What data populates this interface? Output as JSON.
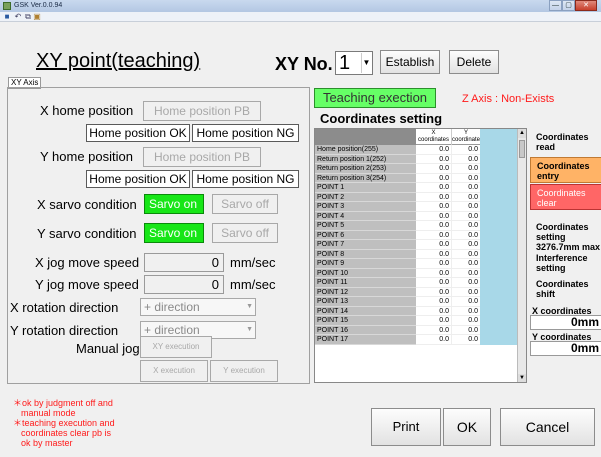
{
  "window": {
    "title": "GSK Ver.0.0.94",
    "minimize": "—",
    "maximize": "▢",
    "close": "✕"
  },
  "toolbar": {
    "icons": [
      "save-icon",
      "undo-icon",
      "copy-icon",
      "paste-icon"
    ]
  },
  "header": {
    "title": "XY point(teaching)",
    "xy_axis_tag": "XY Axis",
    "xy_no_label": "XY No.",
    "xy_no_value": "1",
    "establish_label": "Establish",
    "delete_label": "Delete"
  },
  "left": {
    "x_home_label": "X home position",
    "x_home_pb": "Home position PB",
    "x_home_ok": "Home position OK",
    "x_home_ng": "Home position NG",
    "y_home_label": "Y home position",
    "y_home_pb": "Home position PB",
    "y_home_ok": "Home position OK",
    "y_home_ng": "Home position NG",
    "x_servo_label": "X sarvo condition",
    "x_servo_on": "Sarvo on",
    "x_servo_off": "Sarvo off",
    "y_servo_label": "Y sarvo condition",
    "y_servo_on": "Sarvo on",
    "y_servo_off": "Sarvo off",
    "x_jog_label": "X jog move speed",
    "x_jog_value": "0",
    "x_jog_unit": "mm/sec",
    "y_jog_label": "Y jog move speed",
    "y_jog_value": "0",
    "y_jog_unit": "mm/sec",
    "x_rot_label": "X rotation direction",
    "x_rot_value": "+ direction",
    "y_rot_label": "Y rotation direction",
    "y_rot_value": "+ direction",
    "manual_jog_label": "Manual jog",
    "xy_exec": "XY execution",
    "x_exec": "X execution",
    "y_exec": "Y execution"
  },
  "teaching": {
    "button": "Teaching exection",
    "z_axis_status": "Z Axis : Non-Exists",
    "coords_title": "Coordinates setting"
  },
  "grid": {
    "col_x": "X coordinates",
    "col_y": "Y coordinates",
    "rows": [
      {
        "name": "Home position(255)",
        "x": "0.0",
        "y": "0.0"
      },
      {
        "name": "Return position 1(252)",
        "x": "0.0",
        "y": "0.0"
      },
      {
        "name": "Return position 2(253)",
        "x": "0.0",
        "y": "0.0"
      },
      {
        "name": "Return position 3(254)",
        "x": "0.0",
        "y": "0.0"
      },
      {
        "name": "POINT 1",
        "x": "0.0",
        "y": "0.0"
      },
      {
        "name": "POINT 2",
        "x": "0.0",
        "y": "0.0"
      },
      {
        "name": "POINT 3",
        "x": "0.0",
        "y": "0.0"
      },
      {
        "name": "POINT 4",
        "x": "0.0",
        "y": "0.0"
      },
      {
        "name": "POINT 5",
        "x": "0.0",
        "y": "0.0"
      },
      {
        "name": "POINT 6",
        "x": "0.0",
        "y": "0.0"
      },
      {
        "name": "POINT 7",
        "x": "0.0",
        "y": "0.0"
      },
      {
        "name": "POINT 8",
        "x": "0.0",
        "y": "0.0"
      },
      {
        "name": "POINT 9",
        "x": "0.0",
        "y": "0.0"
      },
      {
        "name": "POINT 10",
        "x": "0.0",
        "y": "0.0"
      },
      {
        "name": "POINT 11",
        "x": "0.0",
        "y": "0.0"
      },
      {
        "name": "POINT 12",
        "x": "0.0",
        "y": "0.0"
      },
      {
        "name": "POINT 13",
        "x": "0.0",
        "y": "0.0"
      },
      {
        "name": "POINT 14",
        "x": "0.0",
        "y": "0.0"
      },
      {
        "name": "POINT 15",
        "x": "0.0",
        "y": "0.0"
      },
      {
        "name": "POINT 16",
        "x": "0.0",
        "y": "0.0"
      },
      {
        "name": "POINT 17",
        "x": "0.0",
        "y": "0.0"
      }
    ]
  },
  "right": {
    "read": "Coordinates read",
    "entry": "Coordinates entry",
    "clear": "Coordinates clear",
    "setting_info": "Coordinates setting 3276.7mm max",
    "interference": "Interference setting",
    "shift": "Coordinates shift",
    "x_label": "X coordinates",
    "x_value": "0mm",
    "y_label": "Y coordinates",
    "y_value": "0mm"
  },
  "footer": {
    "notes": [
      "＊ok by judgment off and",
      "  manual mode",
      "＊teaching execution and",
      "  coordinates clear pb is",
      "  ok by master"
    ],
    "print": "Print",
    "ok": "OK",
    "cancel": "Cancel"
  }
}
